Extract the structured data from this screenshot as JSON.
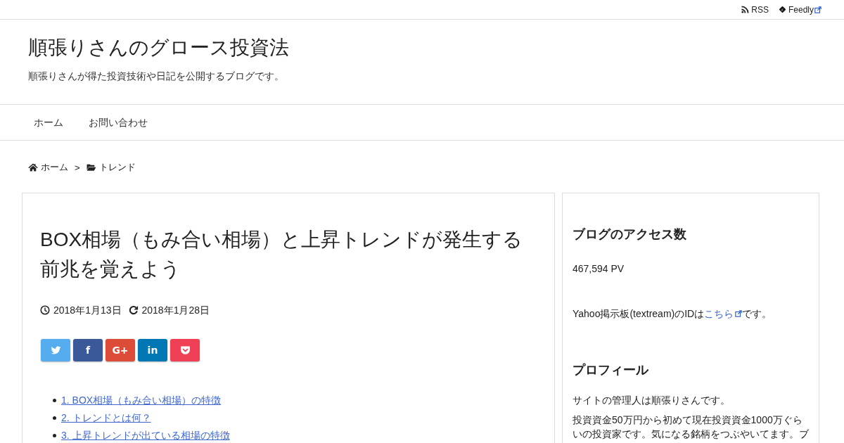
{
  "top_links": [
    {
      "kind": "rss",
      "label": "RSS",
      "external": false
    },
    {
      "kind": "feedly",
      "label": "Feedly",
      "external": true
    }
  ],
  "site": {
    "title": "順張りさんのグロース投資法",
    "description": "順張りさんが得た投資技術や日記を公開するブログです。"
  },
  "nav": [
    {
      "label": "ホーム"
    },
    {
      "label": "お問い合わせ"
    }
  ],
  "breadcrumb": {
    "separator": ">",
    "items": [
      {
        "kind": "home",
        "label": "ホーム"
      },
      {
        "kind": "folder",
        "label": "トレンド"
      }
    ]
  },
  "article": {
    "title": "BOX相場（もみ合い相場）と上昇トレンドが発生する前兆を覚えよう",
    "dates": [
      {
        "kind": "published",
        "text": "2018年1月13日"
      },
      {
        "kind": "updated",
        "text": "2018年1月28日"
      }
    ],
    "share_buttons": [
      {
        "kind": "twitter",
        "color": "#55acee"
      },
      {
        "kind": "text",
        "label": "f",
        "color": "#3b5998"
      },
      {
        "kind": "text",
        "label": "G+",
        "color": "#dd4b39"
      },
      {
        "kind": "text",
        "label": "in",
        "color": "#0077b5"
      },
      {
        "kind": "pocket",
        "color": "#ef4056"
      }
    ],
    "toc": [
      "1. BOX相場（もみ合い相場）の特徴",
      "2. トレンドとは何？",
      "3. 上昇トレンドが出ている相場の特徴"
    ]
  },
  "sidebar": [
    {
      "title": "ブログのアクセス数",
      "content": [
        {
          "kind": "text",
          "text": "467,594 PV"
        }
      ]
    },
    {
      "content": [
        {
          "kind": "link_text",
          "before": "Yahoo掲示板(textream)のIDは",
          "link": "こちら",
          "external": true,
          "after": "です。"
        }
      ]
    },
    {
      "title": "プロフィール",
      "content": [
        {
          "kind": "text",
          "text": "サイトの管理人は順張りさんです。"
        },
        {
          "kind": "text",
          "text": "投資資金50万円から初めて現在投資資金1000万ぐらいの投資家です。気になる銘柄をつぶやいてます。ブ"
        }
      ]
    }
  ]
}
